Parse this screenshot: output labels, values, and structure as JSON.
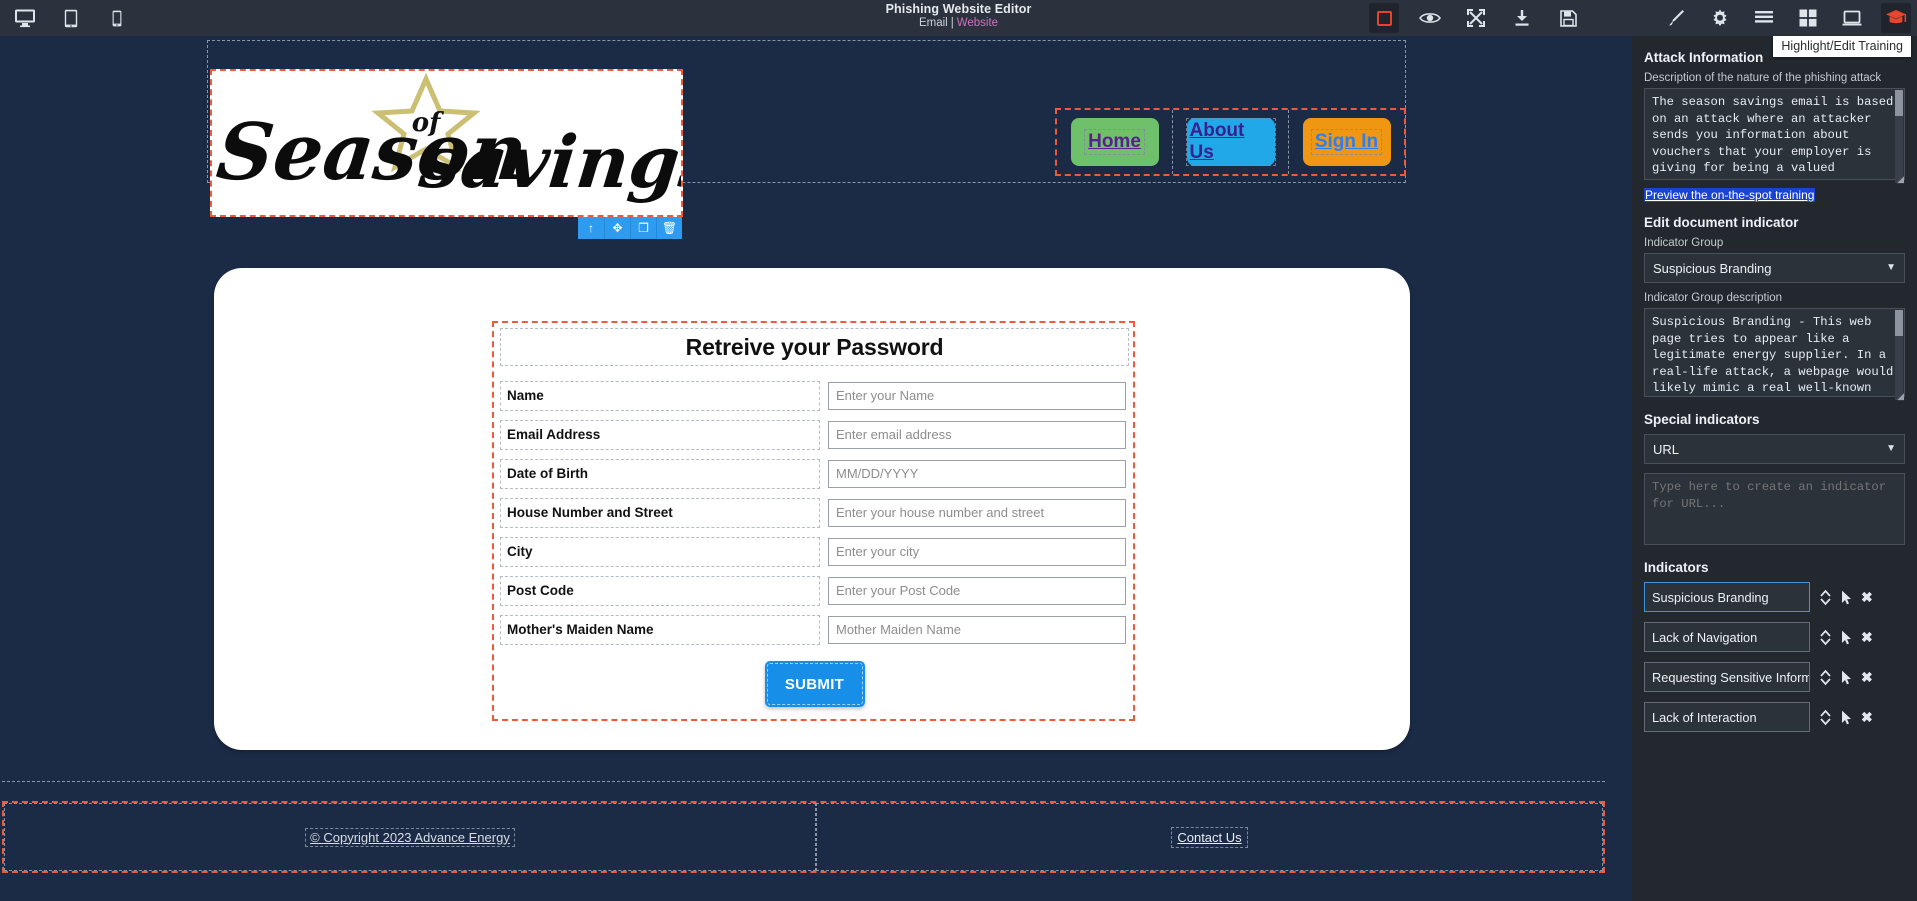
{
  "topbar": {
    "title": "Phishing Website Editor",
    "subtitle": {
      "email": "Email",
      "separator": "|",
      "website": "Website"
    },
    "left_icons": [
      {
        "name": "desktop-icon",
        "label": "Desktop view"
      },
      {
        "name": "tablet-icon",
        "label": "Tablet view"
      },
      {
        "name": "mobile-icon",
        "label": "Mobile view"
      }
    ],
    "right_icons": [
      {
        "name": "stop-record-icon",
        "label": "Stop"
      },
      {
        "name": "eye-icon",
        "label": "Preview"
      },
      {
        "name": "fullscreen-icon",
        "label": "Fullscreen"
      },
      {
        "name": "download-icon",
        "label": "Download"
      },
      {
        "name": "save-icon",
        "label": "Save"
      },
      {
        "name": "paintbrush-icon",
        "label": "Style manager"
      },
      {
        "name": "gear-icon",
        "label": "Settings"
      },
      {
        "name": "layers-icon",
        "label": "Layer manager"
      },
      {
        "name": "blocks-icon",
        "label": "Blocks"
      },
      {
        "name": "screen-icon",
        "label": "Screen"
      },
      {
        "name": "graduation-cap-icon",
        "label": "Highlight/Edit Training"
      }
    ],
    "tooltip": "Highlight/Edit Training",
    "accent_red": "#e8412c",
    "accent_pink": "#d070c0"
  },
  "canvas": {
    "logo": {
      "alt": "Season of savings!",
      "word1": "Season",
      "star_word": "of",
      "word2": "savings!"
    },
    "element_toolbar": [
      {
        "name": "move-up-icon",
        "glyph": "↑"
      },
      {
        "name": "drag-move-icon",
        "glyph": "✥"
      },
      {
        "name": "copy-icon",
        "glyph": "❐"
      },
      {
        "name": "delete-icon",
        "glyph": "🗑"
      }
    ],
    "nav_buttons": [
      {
        "label": "Home",
        "bg": "#6ec06a",
        "color": "#5b1f91"
      },
      {
        "label": "About Us",
        "bg": "#20a8e8",
        "color": "#3b1f8f"
      },
      {
        "label": "Sign In",
        "bg": "#ef9612",
        "color": "#2d7ff0"
      }
    ],
    "form": {
      "title": "Retreive your Password",
      "rows": [
        {
          "label": "Name",
          "placeholder": "Enter your Name"
        },
        {
          "label": "Email Address",
          "placeholder": "Enter email address"
        },
        {
          "label": "Date of Birth",
          "placeholder": "MM/DD/YYYY"
        },
        {
          "label": "House Number and Street",
          "placeholder": "Enter your house number and street"
        },
        {
          "label": "City",
          "placeholder": "Enter your city"
        },
        {
          "label": "Post Code",
          "placeholder": "Enter your Post Code"
        },
        {
          "label": "Mother's Maiden Name",
          "placeholder": "Mother Maiden Name"
        }
      ],
      "submit_label": "SUBMIT"
    },
    "footer": {
      "copyright": "© Copyright 2023 Advance Energy",
      "contact_label": "Contact Us"
    }
  },
  "panel": {
    "attack_information_heading": "Attack Information",
    "attack_description_label": "Description of the nature of the phishing attack",
    "attack_description_value": "The season savings email is based on an attack where an attacker sends you information about vouchers that your employer is giving for being a valued employee. The attacker",
    "preview_training_link": "Preview the on-the-spot training",
    "edit_document_indicator_heading": "Edit document indicator",
    "indicator_group_label": "Indicator Group",
    "indicator_group_value": "Suspicious Branding",
    "indicator_group_description_label": "Indicator Group description",
    "indicator_group_description_value": "Suspicious Branding - This web page tries to appear like a legitimate energy supplier. In a real-life attack, a webpage would likely mimic a real well-known brand.",
    "special_indicators_heading": "Special indicators",
    "special_indicator_type": "URL",
    "special_indicator_placeholder": "Type here to create an indicator for URL...",
    "indicators_heading": "Indicators",
    "indicators": [
      {
        "label": "Suspicious Branding",
        "selected": true
      },
      {
        "label": "Lack of Navigation",
        "selected": false
      },
      {
        "label": "Requesting Sensitive Information",
        "selected": false
      },
      {
        "label": "Lack of Interaction",
        "selected": false
      }
    ],
    "selected_border_color": "#3d93de"
  }
}
